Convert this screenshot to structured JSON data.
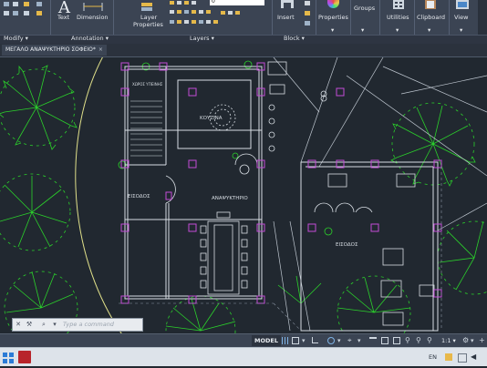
{
  "ribbon": {
    "text_label": "Text",
    "dimension_label": "Dimension",
    "layer_properties_label_1": "Layer",
    "layer_properties_label_2": "Properties",
    "layer_number": "0",
    "insert_label": "Insert",
    "properties_label": "Properties",
    "groups_label": "Groups",
    "utilities_label": "Utilities",
    "clipboard_label": "Clipboard",
    "view_label": "View"
  },
  "panels": {
    "modify": "Modify",
    "annotation": "Annotation",
    "layers": "Layers",
    "block": "Block"
  },
  "document_tab": {
    "title": "ΜΕΓΑΛΟ ΑΝΑΨΥΚΤΗΡΙΟ ΣΟΦΕΙΟ*",
    "close": "×"
  },
  "drawing": {
    "room_label_kouzina": "ΚΟΥΖΙΝΑ",
    "room_label_eisodos_left": "ΕΙΣΟΔΟΣ",
    "room_label_eisodos_right": "ΕΙΣΟΔΟΣ",
    "room_label_anapsyktirio": "ΑΝΑΨΥΚΤΗΡΙΟ",
    "room_label_wc": "ΧΩΡΟΣ ΥΓΙΕΙΝΗΣ"
  },
  "command_line": {
    "placeholder": "Type a command"
  },
  "status_bar": {
    "model_label": "MODEL",
    "scale_label": "1:1"
  },
  "taskbar": {
    "language": "EN"
  },
  "colors": {
    "canvas_bg": "#212830",
    "tree_green": "#2bd12b",
    "wall_white": "#d7dde3",
    "column_magenta": "#c24bd6",
    "site_yellow": "#e0e08a",
    "ribbon_bg": "#3b4453"
  }
}
